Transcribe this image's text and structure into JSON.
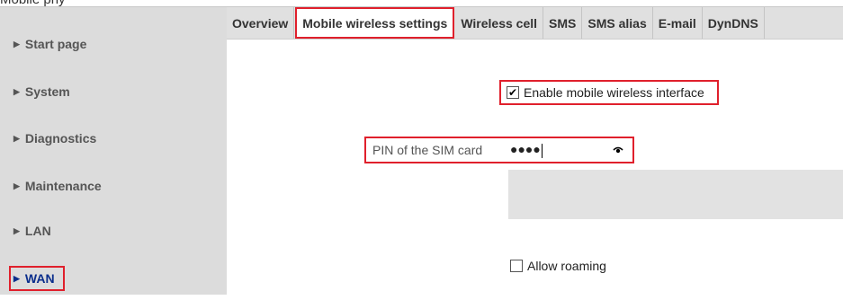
{
  "sidebar": {
    "items": [
      {
        "label": "Start page",
        "active": false
      },
      {
        "label": "System",
        "active": false
      },
      {
        "label": "Diagnostics",
        "active": false
      },
      {
        "label": "Maintenance",
        "active": false
      },
      {
        "label": "LAN",
        "active": false
      },
      {
        "label": "WAN",
        "active": true
      }
    ]
  },
  "tabs": [
    {
      "label": "Overview",
      "active": false
    },
    {
      "label": "Mobile wireless settings",
      "active": true
    },
    {
      "label": "Wireless cell",
      "active": false
    },
    {
      "label": "SMS",
      "active": false
    },
    {
      "label": "SMS alias",
      "active": false
    },
    {
      "label": "E-mail",
      "active": false
    },
    {
      "label": "DynDNS",
      "active": false
    }
  ],
  "form": {
    "enable_mobile": {
      "label": "Enable mobile wireless interface",
      "checked": true
    },
    "pin": {
      "label": "PIN of the SIM card",
      "masked_value": "●●●●"
    },
    "allow_roaming": {
      "label": "Allow roaming",
      "checked": false
    }
  },
  "colors": {
    "highlight": "#e0202c",
    "sidebar_bg": "#dcdcdc",
    "active_nav": "#0b2e8c"
  }
}
